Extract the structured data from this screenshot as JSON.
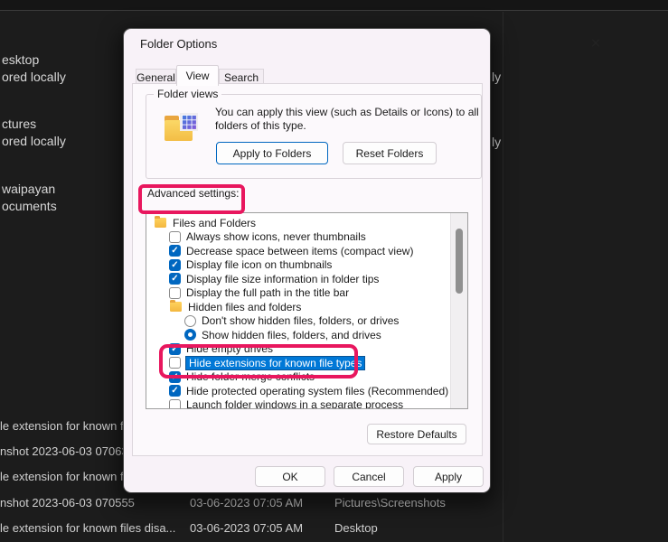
{
  "background": {
    "left_fragments": [
      "esktop",
      "ored locally",
      "ctures",
      "ored locally",
      "waipayan",
      "ocuments"
    ],
    "right_fragments": [
      "ly",
      "ly"
    ],
    "file_rows": [
      {
        "name": "le extension for known f",
        "date": "",
        "folder": ""
      },
      {
        "name": "nshot 2023-06-03 07063",
        "date": "",
        "folder": ""
      },
      {
        "name": "le extension for known f",
        "date": "",
        "folder": ""
      },
      {
        "name": "nshot 2023-06-03 070555",
        "date": "03-06-2023 07:05 AM",
        "folder": "Pictures\\Screenshots"
      },
      {
        "name": "le extension for known files disa...",
        "date": "03-06-2023 07:05 AM",
        "folder": "Desktop"
      }
    ]
  },
  "dialog": {
    "title": "Folder Options",
    "close_glyph": "✕",
    "tabs": [
      "General",
      "View",
      "Search"
    ],
    "active_tab": "View",
    "folder_views": {
      "legend": "Folder views",
      "description": "You can apply this view (such as Details or Icons) to all folders of this type.",
      "apply_button": "Apply to Folders",
      "reset_button": "Reset Folders"
    },
    "advanced_settings_label": "Advanced settings:",
    "list": {
      "items": [
        {
          "type": "folder",
          "label": "Files and Folders"
        },
        {
          "type": "checkbox",
          "state": "unchecked",
          "label": "Always show icons, never thumbnails"
        },
        {
          "type": "checkbox",
          "state": "checked",
          "label": "Decrease space between items (compact view)"
        },
        {
          "type": "checkbox",
          "state": "checked",
          "label": "Display file icon on thumbnails"
        },
        {
          "type": "checkbox",
          "state": "checked",
          "label": "Display file size information in folder tips"
        },
        {
          "type": "checkbox",
          "state": "unchecked",
          "label": "Display the full path in the title bar"
        },
        {
          "type": "folder",
          "label": "Hidden files and folders"
        },
        {
          "type": "radio",
          "state": "off",
          "label": "Don't show hidden files, folders, or drives"
        },
        {
          "type": "radio",
          "state": "on",
          "label": "Show hidden files, folders, and drives"
        },
        {
          "type": "checkbox",
          "state": "checked",
          "label": "Hide empty drives"
        },
        {
          "type": "checkbox",
          "state": "unchecked",
          "label": "Hide extensions for known file types",
          "highlighted": true
        },
        {
          "type": "checkbox",
          "state": "checked",
          "label": "Hide folder merge conflicts"
        },
        {
          "type": "checkbox",
          "state": "checked",
          "label": "Hide protected operating system files (Recommended)"
        },
        {
          "type": "checkbox",
          "state": "unchecked",
          "label": "Launch folder windows in a separate process"
        }
      ]
    },
    "restore_defaults_button": "Restore Defaults",
    "footer": {
      "ok": "OK",
      "cancel": "Cancel",
      "apply": "Apply"
    }
  },
  "annotations": {
    "color": "#e8175e"
  }
}
